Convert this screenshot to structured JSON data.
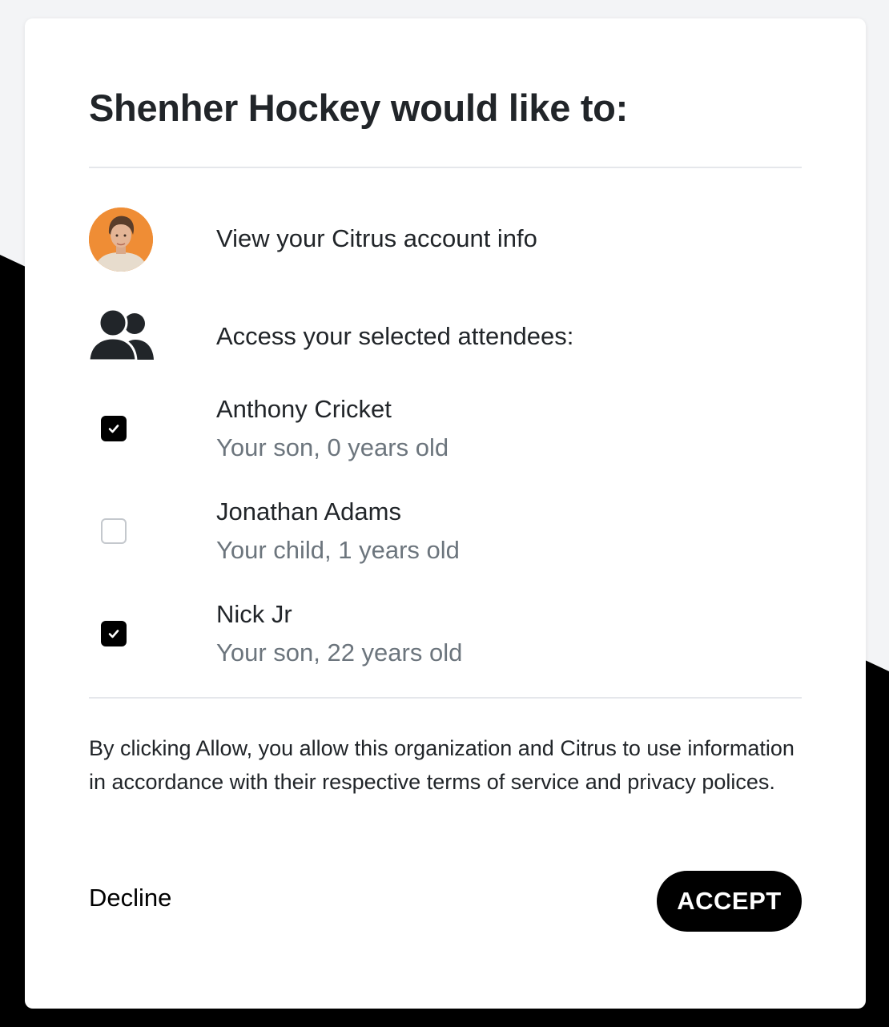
{
  "modal": {
    "title": "Shenher Hockey would like to:"
  },
  "permissions": {
    "account_info": "View your Citrus account info",
    "attendees": "Access your selected attendees:"
  },
  "attendees": [
    {
      "name": "Anthony Cricket",
      "relation": "Your son, 0 years old",
      "checked": true
    },
    {
      "name": "Jonathan Adams",
      "relation": "Your child, 1 years old",
      "checked": false
    },
    {
      "name": "Nick Jr",
      "relation": "Your son, 22 years old",
      "checked": true
    }
  ],
  "consent_text": "By clicking Allow, you allow this organization and Citrus to use information in accordance with their respective terms of service and privacy polices.",
  "actions": {
    "decline_label": "Decline",
    "accept_label": "ACCEPT"
  },
  "icons": {
    "avatar": "user-avatar-photo",
    "attendees": "people-icon",
    "checkbox_checked": "checkmark-icon"
  },
  "colors": {
    "text_primary": "#212529",
    "text_secondary": "#6c757d",
    "avatar_bg": "#ef8d35",
    "button_bg": "#000000"
  }
}
